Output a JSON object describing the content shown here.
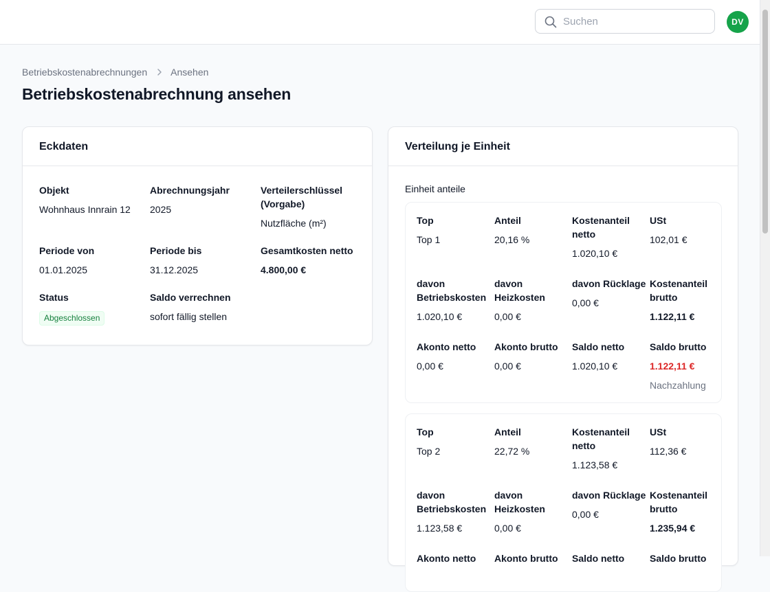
{
  "header": {
    "search_placeholder": "Suchen",
    "avatar_initials": "DV"
  },
  "breadcrumb": {
    "items": [
      "Betriebskostenabrechnungen",
      "Ansehen"
    ]
  },
  "page_title": "Betriebskostenabrechnung ansehen",
  "eckdaten": {
    "title": "Eckdaten",
    "objekt": {
      "label": "Objekt",
      "value": "Wohnhaus Innrain 12"
    },
    "abrechnungsjahr": {
      "label": "Abrechnungsjahr",
      "value": "2025"
    },
    "verteilerschluessel": {
      "label": "Verteilerschlüssel (Vorgabe)",
      "value": "Nutzfläche (m²)"
    },
    "periode_von": {
      "label": "Periode von",
      "value": "01.01.2025"
    },
    "periode_bis": {
      "label": "Periode bis",
      "value": "31.12.2025"
    },
    "gesamtkosten": {
      "label": "Gesamtkosten netto",
      "value": "4.800,00 €"
    },
    "status": {
      "label": "Status",
      "value": "Abgeschlossen"
    },
    "saldo": {
      "label": "Saldo verrechnen",
      "value": "sofort fällig stellen"
    }
  },
  "verteilung": {
    "title": "Verteilung je Einheit",
    "section_label": "Einheit anteile",
    "labels": {
      "top": "Top",
      "anteil": "Anteil",
      "kostenanteil_netto": "Kostenanteil netto",
      "ust": "USt",
      "betriebskosten": "davon Betriebskosten",
      "heizkosten": "davon Heizkosten",
      "ruecklage": "davon Rücklage",
      "kostenanteil_brutto": "Kostenanteil brutto",
      "akonto_netto": "Akonto netto",
      "akonto_brutto": "Akonto brutto",
      "saldo_netto": "Saldo netto",
      "saldo_brutto": "Saldo brutto"
    },
    "units": [
      {
        "top": "Top 1",
        "anteil": "20,16 %",
        "kostenanteil_netto": "1.020,10 €",
        "ust": "102,01 €",
        "betriebskosten": "1.020,10 €",
        "heizkosten": "0,00 €",
        "ruecklage": "0,00 €",
        "kostenanteil_brutto": "1.122,11 €",
        "akonto_netto": "0,00 €",
        "akonto_brutto": "0,00 €",
        "saldo_netto": "1.020,10 €",
        "saldo_brutto": "1.122,11 €",
        "saldo_hint": "Nachzahlung"
      },
      {
        "top": "Top 2",
        "anteil": "22,72 %",
        "kostenanteil_netto": "1.123,58 €",
        "ust": "112,36 €",
        "betriebskosten": "1.123,58 €",
        "heizkosten": "0,00 €",
        "ruecklage": "0,00 €",
        "kostenanteil_brutto": "1.235,94 €"
      }
    ]
  },
  "colors": {
    "accent_green": "#16a34a",
    "negative_red": "#dc2626"
  }
}
